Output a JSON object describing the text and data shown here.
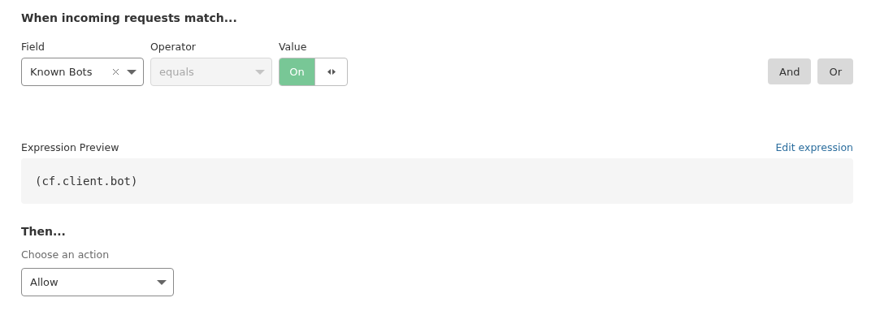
{
  "heading": "When incoming requests match...",
  "condition": {
    "field": {
      "label": "Field",
      "value": "Known Bots",
      "clearable": true
    },
    "operator": {
      "label": "Operator",
      "value": "equals",
      "disabled": true
    },
    "value": {
      "label": "Value",
      "toggle_label": "On",
      "on": true
    }
  },
  "logic_buttons": [
    "And",
    "Or"
  ],
  "expression_preview": {
    "label": "Expression Preview",
    "link": "Edit expression",
    "code": "(cf.client.bot)"
  },
  "then": {
    "heading": "Then...",
    "label": "Choose an action",
    "value": "Allow"
  }
}
